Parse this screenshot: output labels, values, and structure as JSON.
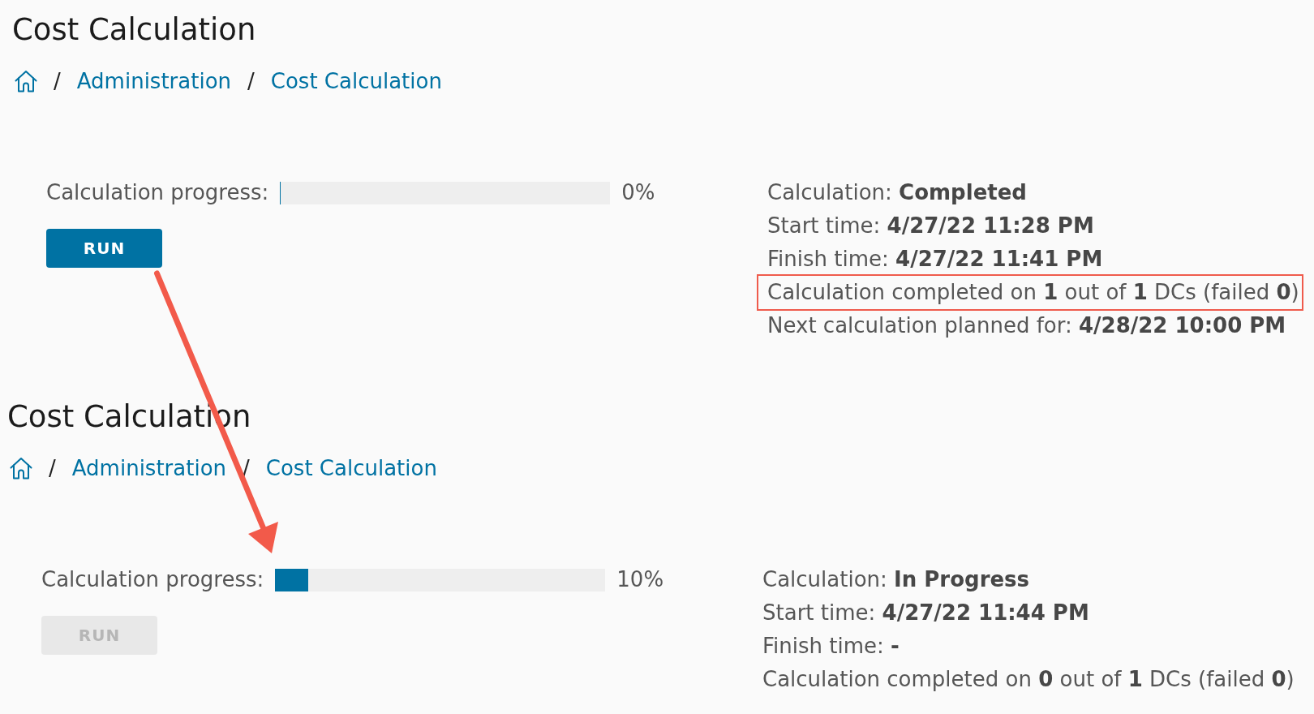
{
  "panels": [
    {
      "title": "Cost Calculation",
      "breadcrumb": [
        {
          "kind": "home"
        },
        {
          "kind": "separator",
          "text": "/"
        },
        {
          "kind": "link",
          "label": "Administration"
        },
        {
          "kind": "separator",
          "text": "/"
        },
        {
          "kind": "link",
          "label": "Cost Calculation"
        }
      ],
      "progress": {
        "label": "Calculation progress:",
        "level": 0,
        "reading": "0%"
      },
      "run_button": {
        "label": "RUN",
        "disabled": false
      },
      "info": [
        {
          "text": "Calculation: **Completed**",
          "highlighted": false
        },
        {
          "text": "Start time: **4/27/22 11:28 PM**",
          "highlighted": false
        },
        {
          "text": "Finish time: **4/27/22 11:41 PM**",
          "highlighted": false
        },
        {
          "text": "Calculation completed on **1** out of **1** DCs (failed **0**)",
          "highlighted": true
        },
        {
          "text": "Next calculation planned for: **4/28/22 10:00 PM**",
          "highlighted": false
        }
      ]
    },
    {
      "title": "Cost Calculation",
      "breadcrumb": [
        {
          "kind": "home"
        },
        {
          "kind": "separator",
          "text": "/"
        },
        {
          "kind": "link",
          "label": "Administration"
        },
        {
          "kind": "separator",
          "text": "/"
        },
        {
          "kind": "link",
          "label": "Cost Calculation"
        }
      ],
      "progress": {
        "label": "Calculation progress:",
        "level": 0.1,
        "reading": "10%"
      },
      "run_button": {
        "label": "RUN",
        "disabled": true
      },
      "info": [
        {
          "text": "Calculation: **In Progress**",
          "highlighted": false
        },
        {
          "text": "Start time: **4/27/22 11:44 PM**",
          "highlighted": false
        },
        {
          "text": "Finish time: **-**",
          "highlighted": false
        },
        {
          "text": "Calculation completed on **0** out of **1** DCs (failed **0**)",
          "highlighted": false
        }
      ]
    }
  ]
}
